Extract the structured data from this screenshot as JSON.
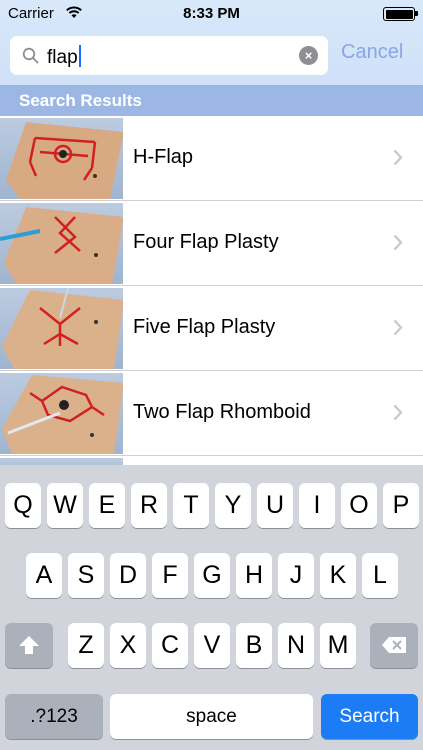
{
  "status": {
    "carrier": "Carrier",
    "time": "8:33 PM"
  },
  "search": {
    "query": "flap",
    "cancel": "Cancel",
    "clear": "×"
  },
  "section_header": "Search Results",
  "results": [
    {
      "title": "H-Flap"
    },
    {
      "title": "Four Flap Plasty"
    },
    {
      "title": "Five Flap Plasty"
    },
    {
      "title": "Two Flap Rhomboid"
    }
  ],
  "keyboard": {
    "row1": [
      "Q",
      "W",
      "E",
      "R",
      "T",
      "Y",
      "U",
      "I",
      "O",
      "P"
    ],
    "row2": [
      "A",
      "S",
      "D",
      "F",
      "G",
      "H",
      "J",
      "K",
      "L"
    ],
    "row3": [
      "Z",
      "X",
      "C",
      "V",
      "B",
      "N",
      "M"
    ],
    "numbers_key": ".?123",
    "space_key": "space",
    "search_key": "Search"
  },
  "icons": {
    "wifi": "wifi-icon",
    "battery": "battery-icon",
    "search": "magnifier-icon",
    "clear": "clear-text-icon",
    "chevron": "chevron-right-icon",
    "shift": "shift-icon",
    "delete": "backspace-icon"
  },
  "colors": {
    "accent": "#1b7cf5",
    "section_header": "#9db7e4",
    "cancel": "#89a6ea"
  }
}
